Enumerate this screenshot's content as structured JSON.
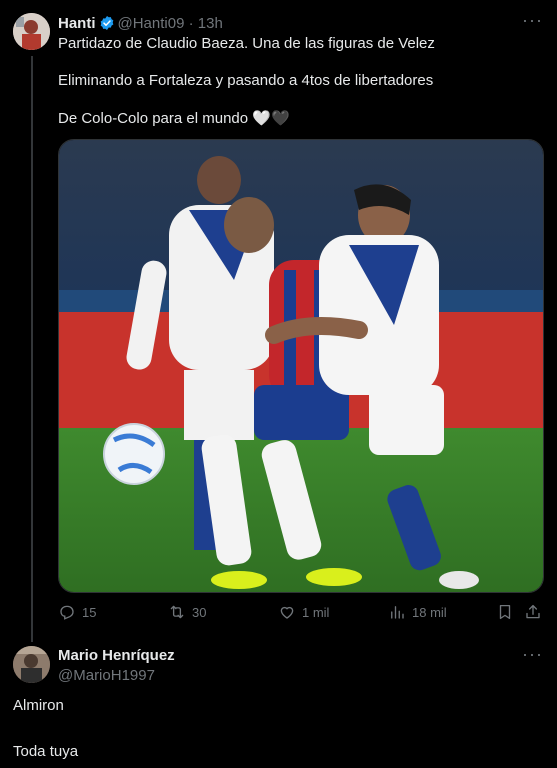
{
  "tweet": {
    "author_name": "Hanti",
    "author_handle": "@Hanti09",
    "time": "13h",
    "more_icon": "more-dots-icon",
    "lines": [
      "Partidazo de Claudio Baeza. Una de las figuras de Velez",
      "Eliminando a Fortaleza y pasando a 4tos de libertadores",
      "De Colo-Colo para el mundo 🤍🖤"
    ],
    "image_description_icon": "soccer-photo",
    "actions": {
      "replies": "15",
      "reposts": "30",
      "likes": "1 mil",
      "views": "18 mil"
    },
    "colors": {
      "verified": "#1d9bf0",
      "muted": "#71767b"
    }
  },
  "reply": {
    "author_name": "Mario Henríquez",
    "author_handle": "@MarioH1997",
    "more_icon": "more-dots-icon",
    "lines": [
      "Almiron",
      "Toda tuya"
    ]
  }
}
